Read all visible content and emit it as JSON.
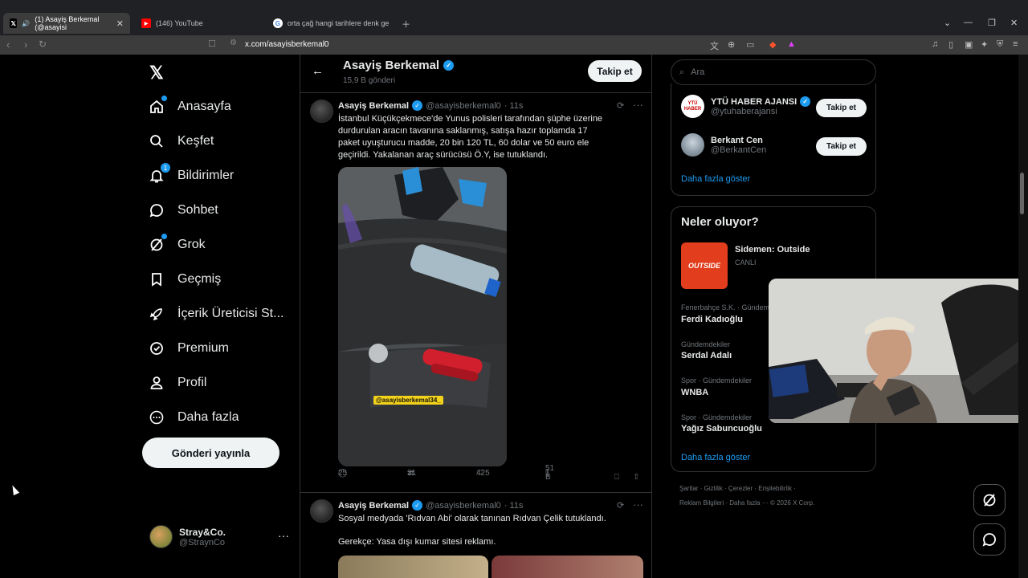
{
  "browser": {
    "tabs": [
      {
        "title": "(1) Asayiş Berkemal (@asayisi",
        "active": true
      },
      {
        "title": "(146) YouTube",
        "active": false
      },
      {
        "title": "orta çağ hangi tarihlere denk geliyor",
        "active": false
      }
    ],
    "url": "x.com/asayisberkemal0"
  },
  "nav": {
    "items": [
      "Anasayfa",
      "Keşfet",
      "Bildirimler",
      "Sohbet",
      "Grok",
      "Geçmiş",
      "İçerik Üreticisi St...",
      "Premium",
      "Profil",
      "Daha fazla"
    ],
    "notifications_badge": "1",
    "post_button": "Gönderi yayınla",
    "account": {
      "name": "Stray&Co.",
      "handle": "@StraynCo"
    }
  },
  "header": {
    "title": "Asayiş Berkemal",
    "subtitle": "15,9 B gönderi",
    "follow": "Takip et"
  },
  "tweets": [
    {
      "name": "Asayiş Berkemal",
      "handle": "@asayisberkemal0",
      "time": "· 11s",
      "text": "İstanbul Küçükçekmece'de Yunus polisleri tarafından şüphe üzerine durdurulan aracın tavanına saklanmış, satışa hazır toplamda 17 paket uyuşturucu madde, 20 bin 120 TL, 60 dolar ve 50 euro ele geçirildi. Yakalanan araç sürücüsü Ö.Y, ise tutuklandı.",
      "watermark": "@asayisberkemal34_",
      "replies": "25",
      "reposts": "31",
      "likes": "425",
      "views": "51 B"
    },
    {
      "name": "Asayiş Berkemal",
      "handle": "@asayisberkemal0",
      "time": "· 11s",
      "text": "Sosyal medyada 'Rıdvan Abi' olarak tanınan Rıdvan Çelik tutuklandı.",
      "text2": "Gerekçe: Yasa dışı kumar sitesi reklamı."
    }
  ],
  "sidebar": {
    "search_placeholder": "Ara",
    "who_to_follow": [
      {
        "name": "YTÜ HABER AJANSI",
        "handle": "@ytuhaberajansi",
        "follow": "Takip et",
        "verified": true
      },
      {
        "name": "Berkant Cen",
        "handle": "@BerkantCen",
        "follow": "Takip et",
        "verified": false
      }
    ],
    "show_more": "Daha fazla göster",
    "trends_title": "Neler oluyor?",
    "live": {
      "title": "Sidemen: Outside",
      "status": "CANLI",
      "thumb_text": "OUTSIDE"
    },
    "trends": [
      {
        "context": "Fenerbahçe S.K. · Gündem",
        "name": "Ferdi Kadıoğlu"
      },
      {
        "context": "Gündemdekiler",
        "name": "Serdal Adalı"
      },
      {
        "context": "Spor · Gündemdekiler",
        "name": "WNBA"
      },
      {
        "context": "Spor · Gündemdekiler",
        "name": "Yağız Sabuncuoğlu"
      }
    ],
    "show_more_2": "Daha fazla göster",
    "footer_line1": [
      "Şartlar",
      "Gizlilik",
      "Çerezler",
      "Erişilebilirlik"
    ],
    "footer_line2": [
      "Reklam Bilgileri",
      "Daha fazla ···",
      "© 2026 X Corp."
    ]
  },
  "colors": {
    "accent": "#1d9bf0",
    "background": "#000000",
    "border": "#2f3336"
  }
}
